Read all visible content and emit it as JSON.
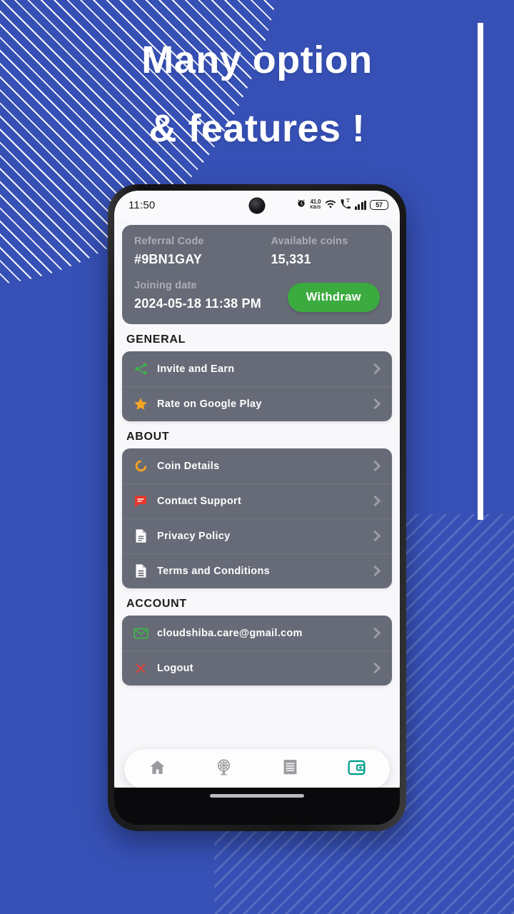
{
  "promo": {
    "background_color": "#3650b5",
    "headline_line1": "Many option",
    "headline_line2": "& features !"
  },
  "phone": {
    "status_bar": {
      "time": "11:50",
      "net_speed_value": "41.0",
      "net_speed_unit": "KB/S",
      "battery_level": "57",
      "icons": [
        "alarm-icon",
        "network-speed-icon",
        "wifi-icon",
        "vowifi-call-icon",
        "signal-bars-icon",
        "battery-icon"
      ]
    },
    "gesture_bar": "home-gesture-bar"
  },
  "app": {
    "info_card": {
      "referral_label": "Referral Code",
      "referral_value": "#9BN1GAY",
      "coins_label": "Available coins",
      "coins_value": "15,331",
      "joining_label": "Joining date",
      "joining_value": "2024-05-18 11:38 PM",
      "withdraw_label": "Withdraw",
      "withdraw_color": "#3cab3f",
      "card_color": "#676b77"
    },
    "sections": [
      {
        "title": "GENERAL",
        "rows": [
          {
            "label": "Invite and Earn",
            "icon": "share-icon",
            "icon_color": "#39b54a"
          },
          {
            "label": "Rate on Google Play",
            "icon": "star-icon",
            "icon_color": "#f5a623"
          }
        ]
      },
      {
        "title": "ABOUT",
        "rows": [
          {
            "label": "Coin Details",
            "icon": "coin-ring-icon",
            "icon_color": "#f0a024"
          },
          {
            "label": "Contact Support",
            "icon": "chat-support-icon",
            "icon_color": "#e8352a"
          },
          {
            "label": "Privacy Policy",
            "icon": "document-icon",
            "icon_color": "#ffffff"
          },
          {
            "label": "Terms and Conditions",
            "icon": "document-lines-icon",
            "icon_color": "#ffffff"
          }
        ]
      },
      {
        "title": "ACCOUNT",
        "rows": [
          {
            "label": "cloudshiba.care@gmail.com",
            "icon": "email-icon",
            "icon_color": "#3cb54a"
          },
          {
            "label": "Logout",
            "icon": "close-x-icon",
            "icon_color": "#e04438"
          }
        ]
      }
    ],
    "bottom_nav": [
      {
        "name": "home",
        "icon": "home-icon",
        "active": false
      },
      {
        "name": "spin",
        "icon": "spin-wheel-icon",
        "active": false
      },
      {
        "name": "history",
        "icon": "receipt-icon",
        "active": false
      },
      {
        "name": "wallet",
        "icon": "wallet-icon",
        "active": true
      }
    ],
    "nav_active_color": "#00a08a",
    "nav_inactive_color": "#9a9a9e"
  }
}
